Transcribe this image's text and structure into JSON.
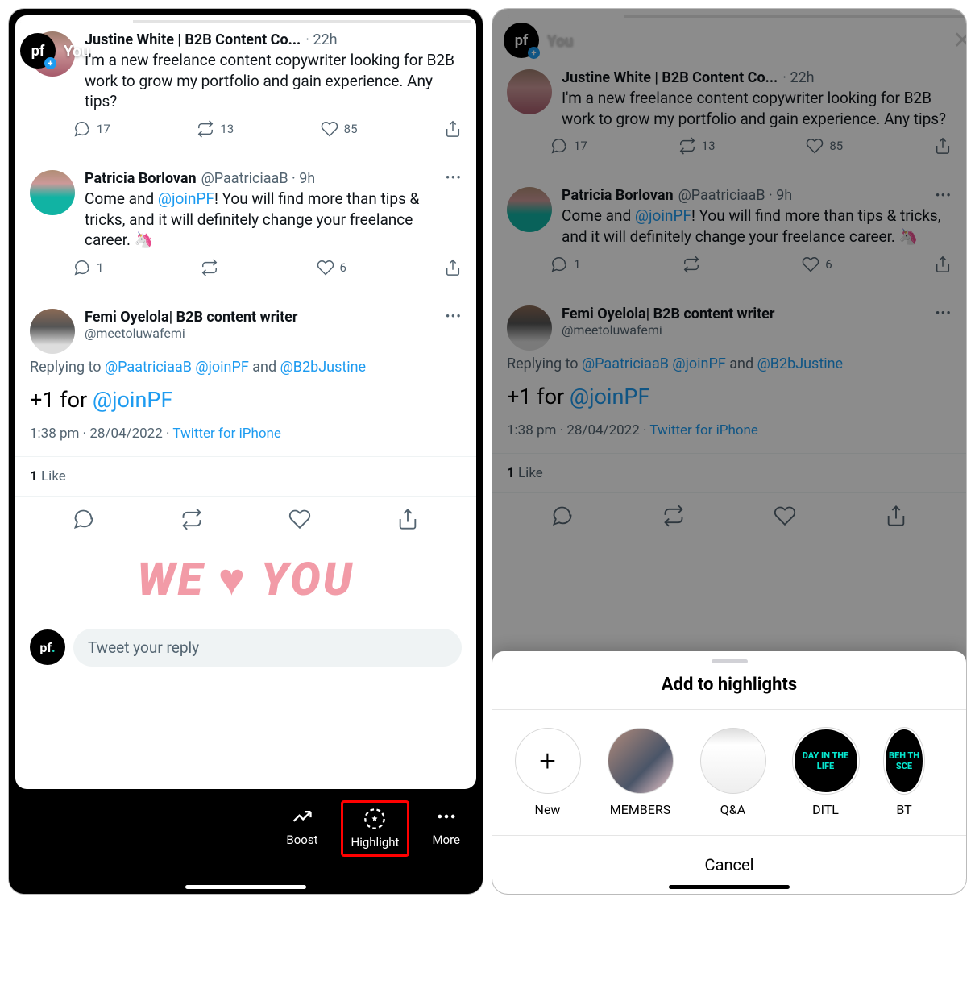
{
  "story": {
    "account_label": "You",
    "pf_text": "pf",
    "close_label": "✕"
  },
  "tweets": {
    "t1": {
      "name": "Justine White | B2B Content Co...",
      "time": "22h",
      "text": "I'm a new freelance content copywriter looking for B2B work to grow my portfolio and gain experience. Any tips?",
      "replies": "17",
      "retweets": "13",
      "likes": "85"
    },
    "t2": {
      "name": "Patricia Borlovan",
      "handle": "@PaatriciaaB",
      "time": "9h",
      "text_before": "Come and ",
      "mention": "@joinPF",
      "text_after": "! You will find more than tips & tricks, and it will definitely change your freelance career. 🦄",
      "replies": "1",
      "likes": "6"
    },
    "t3": {
      "name": "Femi Oyelola| B2B content writer",
      "handle": "@meetoluwafemi",
      "reply_to_prefix": "Replying to ",
      "reply_to_1": "@PaatriciaaB",
      "reply_to_2": "@joinPF",
      "reply_to_and": " and ",
      "reply_to_3": "@B2bJustine",
      "big_text_before": "+1 for ",
      "big_mention": "@joinPF",
      "timestamp": "1:38 pm · 28/04/2022",
      "source_sep": " · ",
      "source": "Twitter for iPhone",
      "like_count": "1",
      "like_word": " Like"
    }
  },
  "sticker": "WE ♥ YOU",
  "reply_input_placeholder": "Tweet your reply",
  "bottom_bar": {
    "boost": "Boost",
    "highlight": "Highlight",
    "more": "More"
  },
  "sheet": {
    "title": "Add to highlights",
    "new_label": "New",
    "items": [
      {
        "label": "MEMBERS"
      },
      {
        "label": "Q&A"
      },
      {
        "label": "DITL",
        "circle_text": "DAY IN\nTHE LIFE"
      },
      {
        "label": "BT",
        "circle_text": "BEH\nTH\nSCE"
      }
    ],
    "cancel": "Cancel"
  }
}
